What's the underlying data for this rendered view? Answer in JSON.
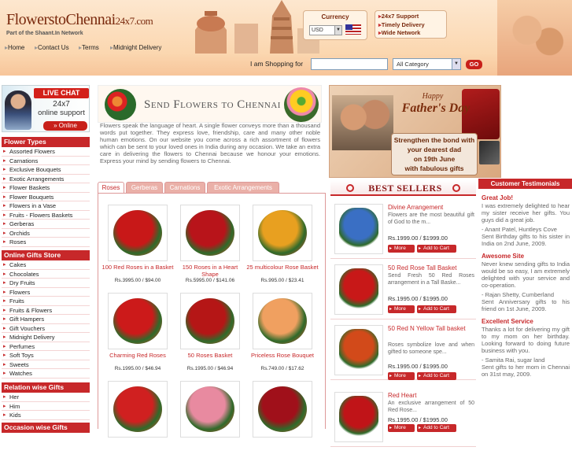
{
  "header": {
    "logo_main": "FlowerstoChennai",
    "logo_suffix": "24x7.com",
    "tagline": "Part of the Shaant.In Network",
    "currency_label": "Currency",
    "currency_value": "USD",
    "support_items": [
      "24x7 Support",
      "Timely Delivery",
      "Wide Network"
    ]
  },
  "nav": [
    "Home",
    "Contact Us",
    "Terms",
    "Midnight Delivery"
  ],
  "search": {
    "label": "I am Shopping for",
    "value": "",
    "category": "All Category",
    "go_label": "GO"
  },
  "livechat": {
    "title": "LIVE CHAT",
    "line1": "24x7",
    "line2": "online support",
    "button": "» Online"
  },
  "sidebar": {
    "sections": [
      {
        "title": "Flower Types",
        "items": [
          "Assorted Flowers",
          "Carnations",
          "Exclusive Bouquets",
          "Exotic Arrangements",
          "Flower Baskets",
          "Flower Bouquets",
          "Flowers in a Vase",
          "Fruits - Flowers Baskets",
          "Gerberas",
          "Orchids",
          "Roses"
        ]
      },
      {
        "title": "Online Gifts Store",
        "items": [
          "Cakes",
          "Chocolates",
          "Dry Fruits",
          "Flowers",
          "Fruits",
          "Fruits & Flowers",
          "Gift Hampers",
          "Gift Vouchers",
          "Midnight Delivery",
          "Perfumes",
          "Soft Toys",
          "Sweets",
          "Watches"
        ]
      },
      {
        "title": "Relation wise Gifts",
        "items": [
          "Her",
          "Him",
          "Kids"
        ]
      },
      {
        "title": "Occasion wise Gifts",
        "items": []
      }
    ]
  },
  "intro": {
    "title": "Send Flowers to Chennai",
    "text": "Flowers speak the language of heart. A single flower conveys more than a thousand words put together. They express love, friendship, care and many other noble human emotions. On our website you come across a rich assortment of flowers which can be sent to your loved ones in India during any occasion. We take an extra care in delivering the flowers to Chennai because we honour your emotions. Express your mind by sending flowers to Chennai."
  },
  "tabs": [
    "Roses",
    "Gerberas",
    "Carnations",
    "Exotic Arrangements"
  ],
  "products": [
    {
      "name": "100 Red Roses in a Basket",
      "price": "Rs.3995.00 / $94.00",
      "color": "#c81818"
    },
    {
      "name": "150 Roses in a Heart Shape",
      "price": "Rs.5995.00 / $141.06",
      "color": "#b8141a"
    },
    {
      "name": "25 multicolour Rose Basket",
      "price": "Rs.995.00 / $23.41",
      "color": "#e8a020"
    },
    {
      "name": "Charming Red Roses",
      "price": "Rs.1995.00 / $46.94",
      "color": "#cc1a1a"
    },
    {
      "name": "50 Roses Basket",
      "price": "Rs.1995.00 / $46.94",
      "color": "#b51616"
    },
    {
      "name": "Priceless Rose Bouquet",
      "price": "Rs.749.00 / $17.62",
      "color": "#f0a060"
    },
    {
      "name": "",
      "price": "",
      "color": "#d02020"
    },
    {
      "name": "",
      "price": "",
      "color": "#e88aa0"
    },
    {
      "name": "",
      "price": "",
      "color": "#a0101a"
    }
  ],
  "banner": {
    "happy": "Happy",
    "title": "Father's Day",
    "lines": [
      "Strengthen the bond with",
      "your dearest dad",
      "on 19th June",
      "with fabulous gifts"
    ]
  },
  "bestsellers": {
    "title": "BEST SELLERS",
    "more_label": "More",
    "cart_label": "Add to Cart",
    "items": [
      {
        "name": "Divine Arrangement",
        "desc": "Flowers are the most beautiful gift of God to the m...",
        "price": "Rs.1999.00 / $1999.00",
        "color": "#3a6fc4"
      },
      {
        "name": "50 Red Rose Tall Basket",
        "desc": "Send Fresh 50 Red Roses arrangement in a Tall Baske...",
        "price": "Rs.1995.00 / $1995.00",
        "color": "#c81818"
      },
      {
        "name": "50 Red N Yellow Tall basket",
        "desc": "Roses symbolize love and when gifted to someone spe...",
        "price": "Rs.1995.00 / $1995.00",
        "color": "#d24a1a"
      },
      {
        "name": "Red Heart",
        "desc": "An exclusive arrangement of 50 Red Rose...",
        "price": "Rs.1995.00 / $1995.00",
        "color": "#c01418"
      }
    ]
  },
  "testimonials": {
    "title": "Customer Testimonials",
    "items": [
      {
        "title": "Great Job!",
        "text": "I was extremely delighted to hear my sister receive her gifts. You guys did a great job.",
        "by": "- Anant Patel, Huntleys Cove",
        "note": "Sent Birthday gifts to his sister in India on 2nd June, 2009."
      },
      {
        "title": "Awesome Site",
        "text": "Never knew sending gifts to India would be so easy, I am extremely delighted with your service and co-operation.",
        "by": "- Rajan Shetty, Cumberland",
        "note": "Sent Anniversary gifts to his friend on 1st June, 2009."
      },
      {
        "title": "Excellent Service",
        "text": "Thanks a lot for delivering my gift to my mom on her birthday. Looking forward to doing future business with you.",
        "by": "- Samita Rai, sugar land",
        "note": "Sent gifts to her mom in Chennai on 31st may, 2009."
      }
    ]
  }
}
